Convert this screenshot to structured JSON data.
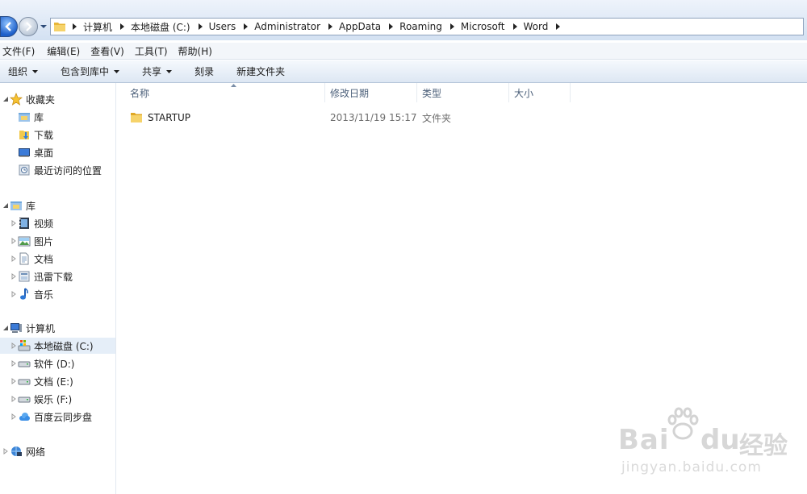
{
  "breadcrumbs": [
    {
      "label": "计算机"
    },
    {
      "label": "本地磁盘 (C:)"
    },
    {
      "label": "Users"
    },
    {
      "label": "Administrator"
    },
    {
      "label": "AppData"
    },
    {
      "label": "Roaming"
    },
    {
      "label": "Microsoft"
    },
    {
      "label": "Word"
    }
  ],
  "menubar": {
    "file": "文件(F)",
    "edit": "编辑(E)",
    "view": "查看(V)",
    "tools": "工具(T)",
    "help": "帮助(H)"
  },
  "commandbar": {
    "organize": "组织",
    "include_library": "包含到库中",
    "share": "共享",
    "burn": "刻录",
    "new_folder": "新建文件夹"
  },
  "navpane": {
    "favorites": {
      "label": "收藏夹",
      "items": [
        "库",
        "下载",
        "桌面",
        "最近访问的位置"
      ]
    },
    "libraries": {
      "label": "库",
      "items": [
        "视频",
        "图片",
        "文档",
        "迅雷下载",
        "音乐"
      ]
    },
    "computer": {
      "label": "计算机",
      "items": [
        "本地磁盘 (C:)",
        "软件 (D:)",
        "文档 (E:)",
        "娱乐 (F:)",
        "百度云同步盘"
      ]
    },
    "network": {
      "label": "网络"
    }
  },
  "columns": {
    "name": "名称",
    "modified": "修改日期",
    "type": "类型",
    "size": "大小"
  },
  "files": [
    {
      "name": "STARTUP",
      "modified": "2013/11/19 15:17",
      "type": "文件夹",
      "size": ""
    }
  ],
  "watermark": {
    "brand_latin_1": "Bai",
    "brand_latin_2": "du",
    "brand_cn": "经验",
    "url": "jingyan.baidu.com"
  },
  "colors": {
    "selection": "#e5eef8",
    "folder": "#f2c94c",
    "accent": "#1d5fc9"
  }
}
